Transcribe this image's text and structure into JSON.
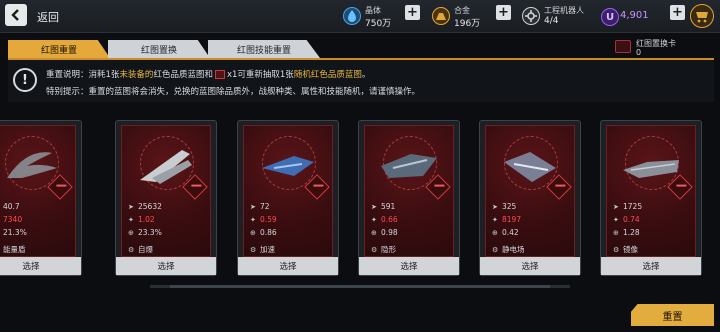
{
  "header": {
    "back_label": "返回",
    "resources": [
      {
        "name": "晶体",
        "value": "750万",
        "icon": "crystal-drop-icon",
        "color": "#4aa3e8"
      },
      {
        "name": "合金",
        "value": "196万",
        "icon": "alloy-icon",
        "color": "#e0a63a"
      },
      {
        "name": "工程机器人",
        "value": "4/4",
        "icon": "robot-icon",
        "color": "#d8dadc"
      }
    ],
    "premium": {
      "symbol": "U",
      "value": "4,901",
      "color": "#9b5cff"
    }
  },
  "tabs": [
    {
      "label": "红图重置",
      "active": true
    },
    {
      "label": "红图置换",
      "active": false
    },
    {
      "label": "红图技能重置",
      "active": false
    }
  ],
  "swap_card": {
    "name": "红图置换卡",
    "count": "0"
  },
  "info": {
    "line1_prefix": "重置说明：消耗1张",
    "line1_hl1": "未装备的",
    "line1_mid": "红色品质蓝图和",
    "line1_after_icon": "x1可重新抽取1张",
    "line1_hl2": "随机红色品质蓝图",
    "line1_end": "。",
    "line2": "特别提示：重置的蓝图将会消失，兑换的蓝图除品质外，战舰种类、属性和技能随机，请谨慎操作。"
  },
  "cards": [
    {
      "s1": "40.7",
      "s2": "7340",
      "s3": "21.3%",
      "skill": "能量盾",
      "select": "选择",
      "ship": "claw"
    },
    {
      "s1": "25632",
      "s2": "1.02",
      "s3": "23.3%",
      "skill": "自爆",
      "select": "选择",
      "ship": "fighter"
    },
    {
      "s1": "72",
      "s2": "0.59",
      "s3": "0.86",
      "skill": "加速",
      "select": "选择",
      "ship": "interceptor"
    },
    {
      "s1": "591",
      "s2": "0.66",
      "s3": "0.98",
      "skill": "隐形",
      "select": "选择",
      "ship": "bomber"
    },
    {
      "s1": "325",
      "s2": "8197",
      "s3": "0.42",
      "skill": "静电场",
      "select": "选择",
      "ship": "corvette"
    },
    {
      "s1": "1725",
      "s2": "0.74",
      "s3": "1.28",
      "skill": "镜像",
      "select": "选择",
      "ship": "frigate"
    }
  ],
  "reset_button": "重置"
}
